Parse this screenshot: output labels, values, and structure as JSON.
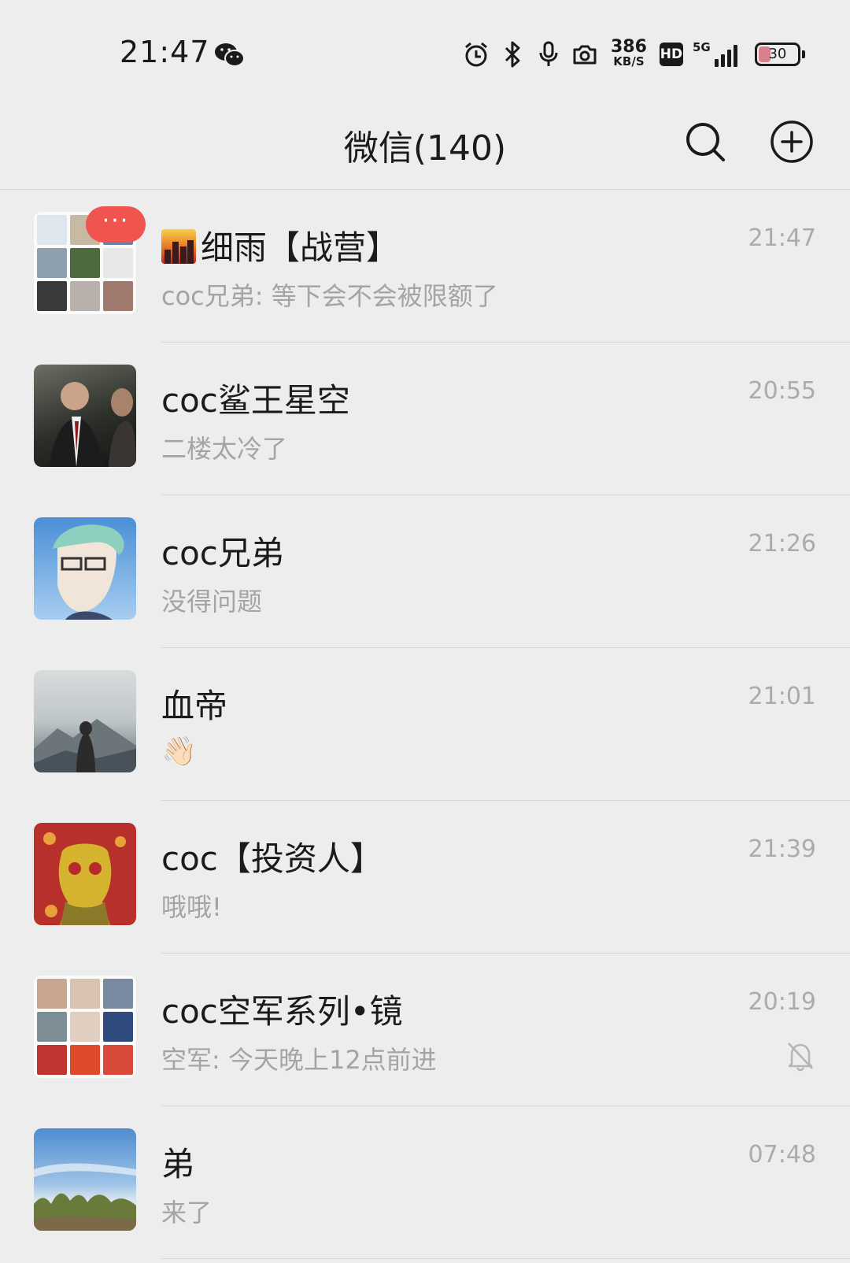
{
  "status_bar": {
    "time": "21:47",
    "net_speed_value": "386",
    "net_speed_unit": "KB/S",
    "hd_label": "HD",
    "network_type": "5G",
    "battery_level": "30",
    "icons": [
      "wechat-icon",
      "alarm-icon",
      "bluetooth-icon",
      "microphone-icon",
      "camera-icon",
      "hd-icon",
      "signal-icon",
      "battery-icon"
    ]
  },
  "header": {
    "title": "微信(140)",
    "icons": [
      "search-icon",
      "add-circle-icon"
    ]
  },
  "chats": [
    {
      "name": "细雨【战营】",
      "preview": "coc兄弟: 等下会不会被限额了",
      "time": "21:47",
      "badge": "···",
      "name_emoji": "city-sunset-emoji"
    },
    {
      "name": "coc鲨王星空",
      "preview": "二楼太冷了",
      "time": "20:55"
    },
    {
      "name": "coc兄弟",
      "preview": "没得问题",
      "time": "21:26"
    },
    {
      "name": "血帝",
      "preview": "👋🏻",
      "time": "21:01"
    },
    {
      "name": "coc【投资人】",
      "preview": "哦哦!",
      "time": "21:39"
    },
    {
      "name": "coc空军系列•镜",
      "preview": "空军: 今天晚上12点前进",
      "time": "20:19",
      "muted": true
    },
    {
      "name": "弟",
      "preview": "来了",
      "time": "07:48"
    }
  ],
  "colors": {
    "background": "#ededed",
    "badge": "#f0544f",
    "secondary_text": "#a4a4a4"
  }
}
